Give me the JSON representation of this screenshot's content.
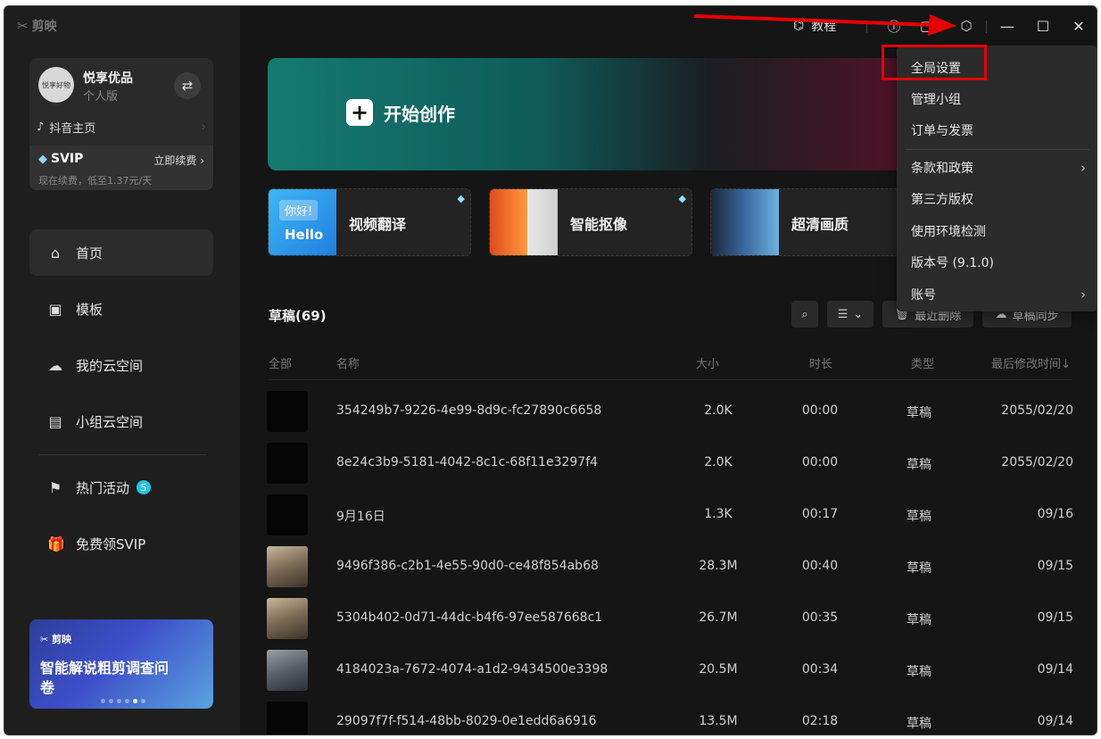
{
  "app": {
    "logo": "剪映"
  },
  "user": {
    "avatar_text": "悦享好物",
    "name": "悦享优品",
    "plan": "个人版",
    "douyin_label": "抖音主页",
    "svip_label": "SVIP",
    "renew_label": "立即续费",
    "renew_note": "现在续费，低至1.37元/天"
  },
  "nav": [
    {
      "label": "首页",
      "icon": "home-icon"
    },
    {
      "label": "模板",
      "icon": "template-icon"
    },
    {
      "label": "我的云空间",
      "icon": "cloud-icon"
    },
    {
      "label": "小组云空间",
      "icon": "group-cloud-icon"
    },
    {
      "label": "热门活动",
      "icon": "flag-icon",
      "badge": "5"
    },
    {
      "label": "免费领SVIP",
      "icon": "gift-icon"
    }
  ],
  "promo": {
    "logo": "剪映",
    "title": "智能解说粗剪调查问卷"
  },
  "topbar": {
    "tutorial": "教程"
  },
  "hero": {
    "label": "开始创作"
  },
  "features": [
    {
      "label": "视频翻译",
      "thumb_text1": "你好!",
      "thumb_text2": "Hello"
    },
    {
      "label": "智能抠像"
    },
    {
      "label": "超清画质"
    }
  ],
  "drafts": {
    "title": "草稿(69)",
    "recent_deleted": "最近删除",
    "sync": "草稿同步",
    "columns": [
      "全部",
      "名称",
      "大小",
      "时长",
      "类型",
      "最后修改时间↓"
    ],
    "rows": [
      {
        "name": "354249b7-9226-4e99-8d9c-fc27890c6658",
        "size": "2.0K",
        "duration": "00:00",
        "type": "草稿",
        "date": "2055/02/20",
        "thumb": "dark"
      },
      {
        "name": "8e24c3b9-5181-4042-8c1c-68f11e3297f4",
        "size": "2.0K",
        "duration": "00:00",
        "type": "草稿",
        "date": "2055/02/20",
        "thumb": "dark"
      },
      {
        "name": "9月16日",
        "size": "1.3K",
        "duration": "00:17",
        "type": "草稿",
        "date": "09/16",
        "thumb": "dark"
      },
      {
        "name": "9496f386-c2b1-4e55-90d0-ce48f854ab68",
        "size": "28.3M",
        "duration": "00:40",
        "type": "草稿",
        "date": "09/15",
        "thumb": "photo"
      },
      {
        "name": "5304b402-0d71-44dc-b4f6-97ee587668c1",
        "size": "26.7M",
        "duration": "00:35",
        "type": "草稿",
        "date": "09/15",
        "thumb": "photo"
      },
      {
        "name": "4184023a-7672-4074-a1d2-9434500e3398",
        "size": "20.5M",
        "duration": "00:34",
        "type": "草稿",
        "date": "09/14",
        "thumb": "photo2"
      },
      {
        "name": "29097f7f-f514-48bb-8029-0e1edd6a6916",
        "size": "13.5M",
        "duration": "02:18",
        "type": "草稿",
        "date": "09/14",
        "thumb": "dark"
      }
    ]
  },
  "menu": {
    "items": [
      {
        "label": "全局设置"
      },
      {
        "label": "管理小组"
      },
      {
        "label": "订单与发票"
      },
      {
        "label": "条款和政策",
        "submenu": true
      },
      {
        "label": "第三方版权"
      },
      {
        "label": "使用环境检测"
      },
      {
        "label": "版本号 (9.1.0)"
      },
      {
        "label": "账号",
        "submenu": true
      }
    ]
  },
  "colors": {
    "highlight": "#e60000",
    "badge": "#1ec8e6",
    "background": "#151515"
  }
}
